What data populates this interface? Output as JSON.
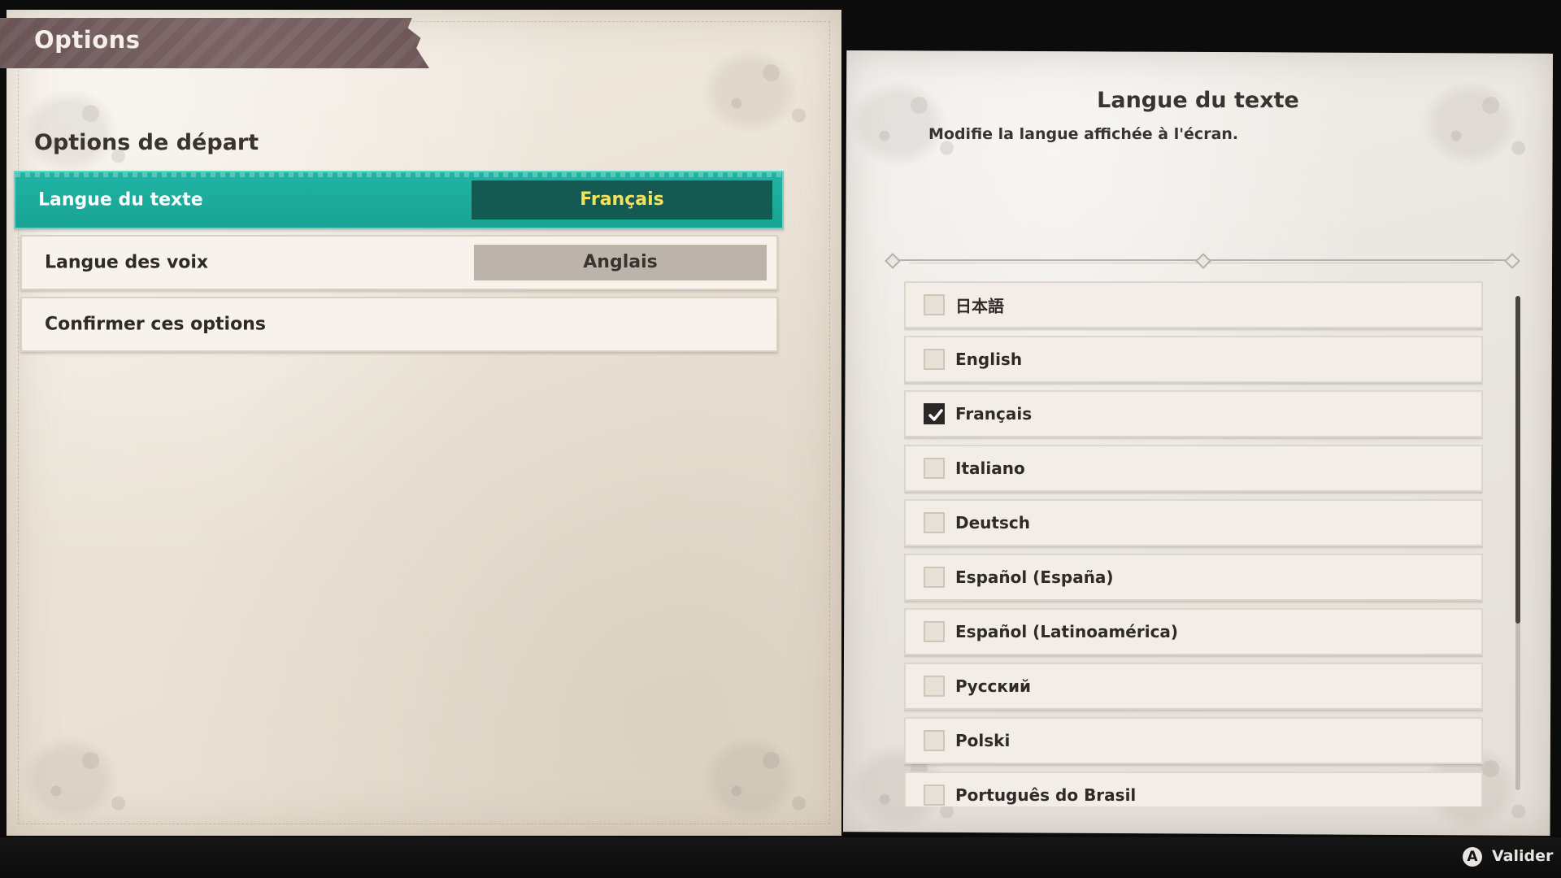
{
  "header": {
    "title": "Options"
  },
  "left": {
    "section_title": "Options de départ",
    "rows": [
      {
        "label": "Langue du texte",
        "value": "Français",
        "selected": true
      },
      {
        "label": "Langue des voix",
        "value": "Anglais",
        "selected": false
      },
      {
        "label": "Confirmer ces options",
        "value": "",
        "selected": false
      }
    ]
  },
  "detail": {
    "title": "Langue du texte",
    "description": "Modifie la langue affichée à l'écran."
  },
  "languages": [
    {
      "label": "日本語",
      "checked": false
    },
    {
      "label": "English",
      "checked": false
    },
    {
      "label": "Français",
      "checked": true
    },
    {
      "label": "Italiano",
      "checked": false
    },
    {
      "label": "Deutsch",
      "checked": false
    },
    {
      "label": "Español (España)",
      "checked": false
    },
    {
      "label": "Español (Latinoamérica)",
      "checked": false
    },
    {
      "label": "Русский",
      "checked": false
    },
    {
      "label": "Polski",
      "checked": false
    },
    {
      "label": "Português do Brasil",
      "checked": false
    }
  ],
  "footer": {
    "button_glyph": "A",
    "action_label": "Valider"
  },
  "colors": {
    "selection_teal": "#1fb2a2",
    "selected_value_bg": "#145a53",
    "selected_value_text": "#f3e35a",
    "banner": "#715a5c"
  }
}
